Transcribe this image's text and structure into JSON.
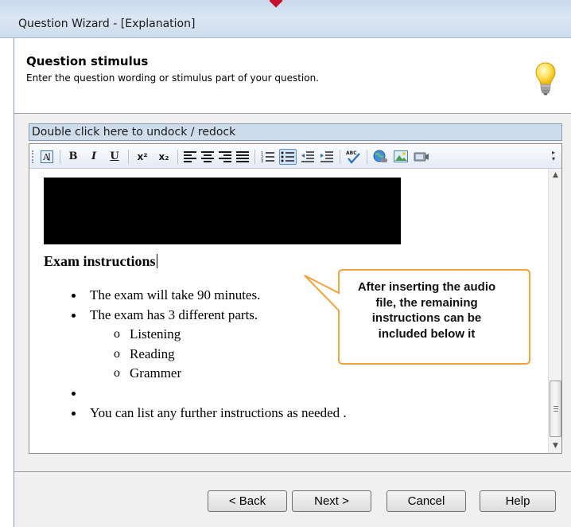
{
  "window": {
    "title": "Question Wizard - [Explanation]"
  },
  "header": {
    "title": "Question stimulus",
    "subtitle": "Enter the question wording or stimulus part of your question."
  },
  "dock_bar": {
    "label": "Double click here to undock / redock"
  },
  "toolbar": {
    "buttons": [
      "text-frame",
      "bold",
      "italic",
      "underline",
      "superscript",
      "subscript",
      "align-left",
      "align-center",
      "align-right",
      "justify",
      "numbered-list",
      "bulleted-list",
      "decrease-indent",
      "increase-indent",
      "spell-check",
      "insert-link",
      "insert-image",
      "insert-media"
    ],
    "bold_glyph": "B",
    "italic_glyph": "I",
    "underline_glyph": "U",
    "superscript_glyph": "x²",
    "subscript_glyph": "x₂",
    "spell_glyph": "ABC"
  },
  "content": {
    "heading": "Exam instructions",
    "bullets": [
      "The exam will take 90 minutes.",
      "The exam has 3 different parts.",
      "",
      "You can list any further instructions as needed ."
    ],
    "sub_bullets": [
      "Listening",
      "Reading",
      "Grammer"
    ],
    "sub_marker": "o"
  },
  "callout": {
    "lines": [
      "After inserting the audio",
      "file, the remaining",
      "instructions can be",
      "included below it"
    ],
    "border_color": "#f5a23a"
  },
  "footer": {
    "back": "< Back",
    "next": "Next >",
    "cancel": "Cancel",
    "help": "Help"
  },
  "colors": {
    "titlebar": "#cfdcec",
    "dockbar": "#cfdceb",
    "redaction": "#000000"
  }
}
